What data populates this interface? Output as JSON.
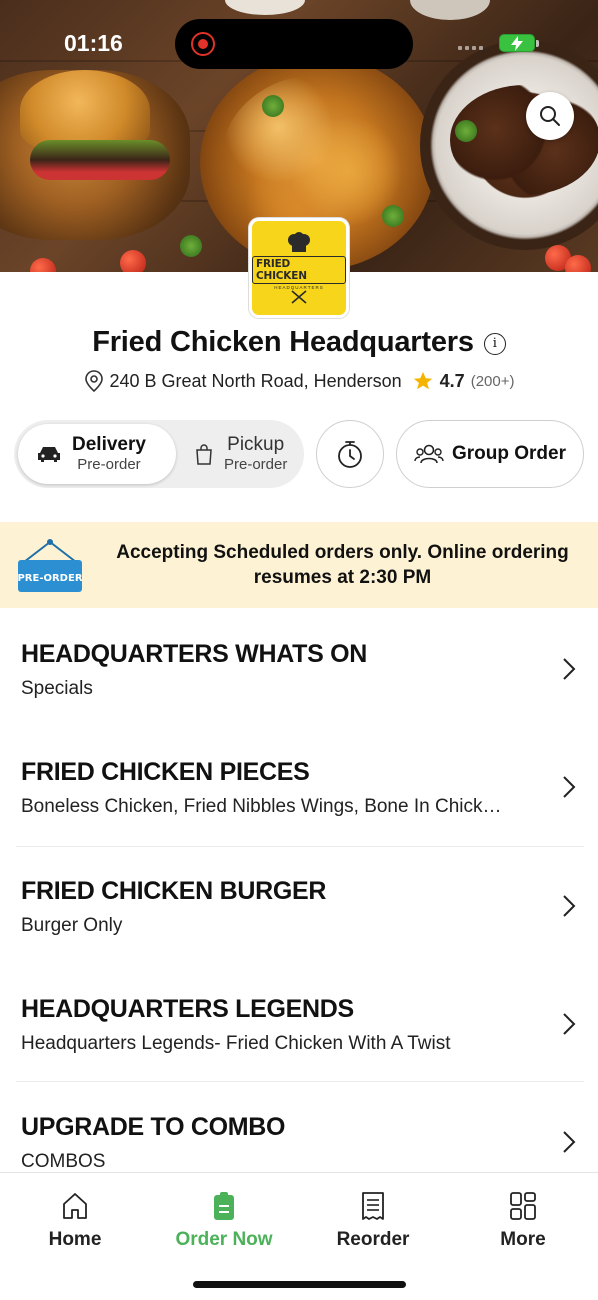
{
  "status_bar": {
    "time": "01:16"
  },
  "store": {
    "logo_text": "FRIED CHICKEN",
    "logo_subtext": "HEADQUARTERS",
    "name": "Fried Chicken Headquarters",
    "address": "240 B Great North Road, Henderson",
    "rating": "4.7",
    "rating_count": "(200+)"
  },
  "order_mode": {
    "delivery_label": "Delivery",
    "delivery_sub": "Pre-order",
    "pickup_label": "Pickup",
    "pickup_sub": "Pre-order",
    "selected": "delivery"
  },
  "group_order_label": "Group Order",
  "banner": {
    "sign_text": "PRE-ORDER",
    "message": "Accepting Scheduled orders only. Online ordering resumes at 2:30 PM"
  },
  "menu": [
    {
      "title": "HEADQUARTERS WHATS ON",
      "subtitle": "Specials"
    },
    {
      "title": "FRIED CHICKEN PIECES",
      "subtitle": "Boneless Chicken, Fried Nibbles Wings, Bone In Chick…"
    },
    {
      "title": "FRIED CHICKEN BURGER",
      "subtitle": "Burger Only"
    },
    {
      "title": "HEADQUARTERS LEGENDS",
      "subtitle": "Headquarters Legends- Fried Chicken With A Twist"
    },
    {
      "title": "UPGRADE TO COMBO",
      "subtitle": "COMBOS"
    }
  ],
  "bottom_nav": [
    {
      "label": "Home",
      "icon": "home-icon"
    },
    {
      "label": "Order Now",
      "icon": "order-icon",
      "active": true
    },
    {
      "label": "Reorder",
      "icon": "receipt-icon"
    },
    {
      "label": "More",
      "icon": "grid-icon"
    }
  ],
  "colors": {
    "accent_green": "#4cb25a",
    "banner_bg": "#fdf3d4",
    "logo_yellow": "#f7d51a",
    "star": "#f5b400"
  }
}
